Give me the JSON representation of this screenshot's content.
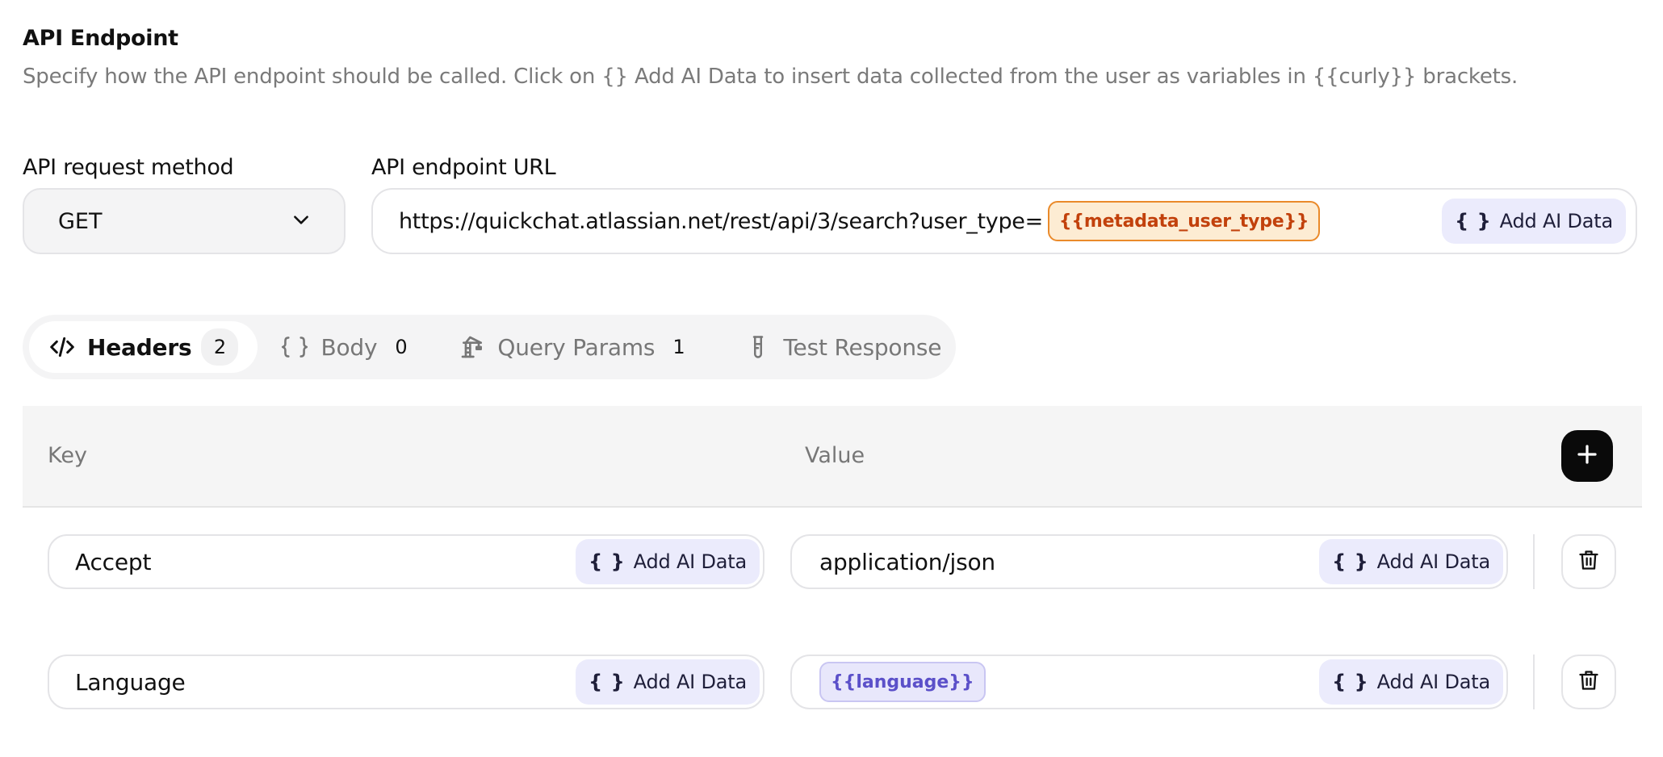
{
  "section": {
    "title": "API Endpoint",
    "description": "Specify how the API endpoint should be called. Click on {} Add AI Data to insert data collected from the user as variables in {{curly}} brackets."
  },
  "method": {
    "label": "API request method",
    "value": "GET"
  },
  "endpoint": {
    "label": "API endpoint URL",
    "url": "https://quickchat.atlassian.net/rest/api/3/search?user_type=",
    "variable": "{{metadata_user_type}}",
    "add_ai_label": "Add AI Data",
    "add_ai_icon": "{ }"
  },
  "tabs": [
    {
      "label": "Headers",
      "count": "2",
      "icon": "code-icon",
      "active": true
    },
    {
      "label": "Body",
      "count": "0",
      "icon": "braces-icon",
      "active": false
    },
    {
      "label": "Query Params",
      "count": "1",
      "icon": "crane-icon",
      "active": false
    },
    {
      "label": "Test Response",
      "count": "",
      "icon": "test-tube-icon",
      "active": false
    }
  ],
  "table": {
    "key_header": "Key",
    "value_header": "Value",
    "rows": [
      {
        "key": "Accept",
        "value": "application/json",
        "value_is_variable": false
      },
      {
        "key": "Language",
        "value": "{{language}}",
        "value_is_variable": true
      }
    ],
    "add_ai_label": "Add AI Data",
    "add_ai_icon": "{ }"
  },
  "colors": {
    "accent_purple": "#5b50c9",
    "accent_orange": "#c2410c",
    "add_ai_bg": "#ebebfc"
  }
}
